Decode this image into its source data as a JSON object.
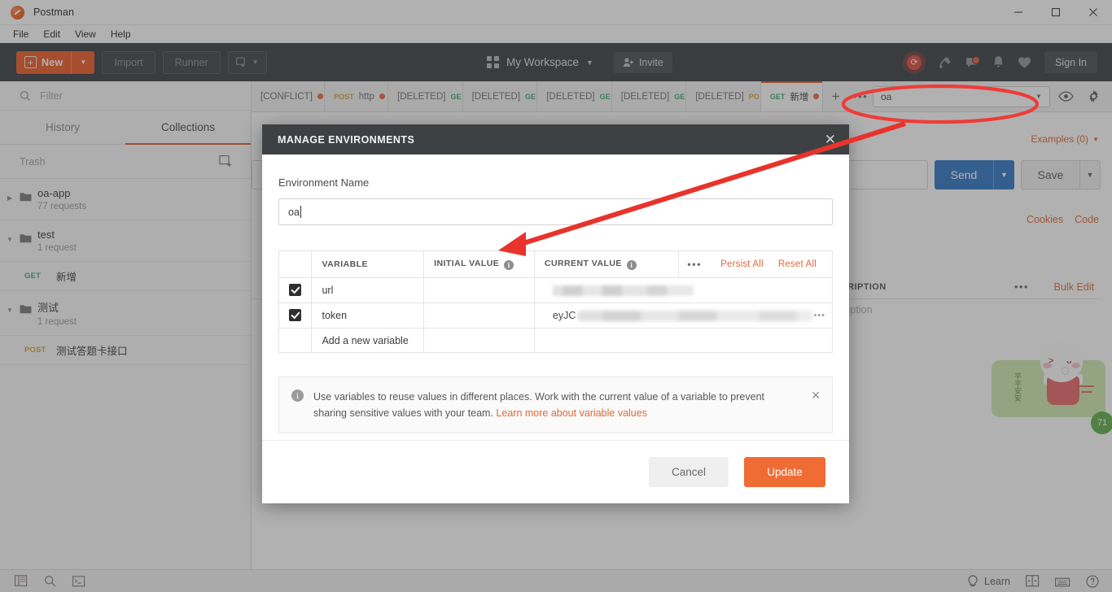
{
  "window": {
    "app_title": "Postman",
    "minimize_icon": "minimize-icon",
    "maximize_icon": "maximize-icon",
    "close_icon": "close-icon"
  },
  "menubar": {
    "items": [
      "File",
      "Edit",
      "View",
      "Help"
    ]
  },
  "toolbar": {
    "new_label": "New",
    "import_label": "Import",
    "runner_label": "Runner",
    "workspace_label": "My Workspace",
    "invite_label": "Invite",
    "signin_label": "Sign In",
    "accent_color": "#ef5b25",
    "background_color": "#3a3f41"
  },
  "sidebar": {
    "filter_placeholder": "Filter",
    "tabs": [
      {
        "label": "History",
        "active": false
      },
      {
        "label": "Collections",
        "active": true
      }
    ],
    "trash_label": "Trash",
    "collections": [
      {
        "name": "oa-app",
        "sub": "77 requests",
        "expanded": false
      },
      {
        "name": "test",
        "sub": "1 request",
        "expanded": true
      },
      {
        "name": "测试",
        "sub": "1 request",
        "expanded": true
      }
    ],
    "requests": [
      {
        "method": "GET",
        "name": "新增"
      },
      {
        "method": "POST",
        "name": "测试答题卡接口"
      }
    ]
  },
  "tabstrip": {
    "tabs": [
      {
        "label": "[CONFLICT]",
        "method": "",
        "dirty": true,
        "active": false
      },
      {
        "label": "http",
        "method": "POST",
        "dirty": true,
        "active": false
      },
      {
        "label": "[DELETED]",
        "method": "GE",
        "dirty": false,
        "active": false
      },
      {
        "label": "[DELETED]",
        "method": "GE",
        "dirty": false,
        "active": false
      },
      {
        "label": "[DELETED]",
        "method": "GE",
        "dirty": false,
        "active": false
      },
      {
        "label": "[DELETED]",
        "method": "GE",
        "dirty": false,
        "active": false
      },
      {
        "label": "[DELETED]",
        "method": "PO",
        "dirty": false,
        "active": false
      },
      {
        "label": "新增",
        "method": "GET",
        "dirty": true,
        "active": true
      }
    ],
    "add_icon": "plus-icon",
    "more_icon": "ellipsis-icon",
    "environment_selected": "oa",
    "eye_icon": "eye-icon",
    "gear_icon": "gear-icon"
  },
  "content": {
    "examples_label": "Examples (0)",
    "send_label": "Send",
    "save_label": "Save",
    "cookies_label": "Cookies",
    "code_label": "Code",
    "description_header": "DESCRIPTION",
    "description_placeholder": "Description",
    "bulk_edit_label": "Bulk Edit"
  },
  "modal": {
    "title": "MANAGE ENVIRONMENTS",
    "close_icon": "close-icon",
    "env_name_label": "Environment Name",
    "env_name_value": "oa",
    "table": {
      "headers": [
        "",
        "VARIABLE",
        "INITIAL VALUE",
        "CURRENT VALUE",
        ""
      ],
      "persist_all_label": "Persist All",
      "reset_all_label": "Reset All",
      "more_icon": "ellipsis-icon",
      "rows": [
        {
          "checked": true,
          "variable": "url",
          "initial_value": "",
          "current_value": "",
          "redacted": true
        },
        {
          "checked": true,
          "variable": "token",
          "initial_value": "",
          "current_value": "eyJC",
          "redacted": true
        }
      ],
      "new_row_placeholder": "Add a new variable"
    },
    "info": {
      "icon": "info-icon",
      "text": "Use variables to reuse values in different places. Work with the current value of a variable to prevent sharing sensitive values with your team.",
      "link_label": "Learn more about variable values",
      "dismiss_icon": "close-icon"
    },
    "cancel_label": "Cancel",
    "update_label": "Update"
  },
  "statusbar": {
    "left_icons": [
      "sidebar-toggle-icon",
      "search-icon",
      "console-icon"
    ],
    "learn_label": "Learn",
    "right_icons": [
      "grid-icon",
      "keyboard-icon",
      "help-icon"
    ]
  },
  "annotation": {
    "ellipse_color": "#ef3b36",
    "arrow_color": "#e8332c",
    "target": "environment-selector"
  },
  "sticker": {
    "badge_text": "71",
    "caption": "平平安安"
  }
}
